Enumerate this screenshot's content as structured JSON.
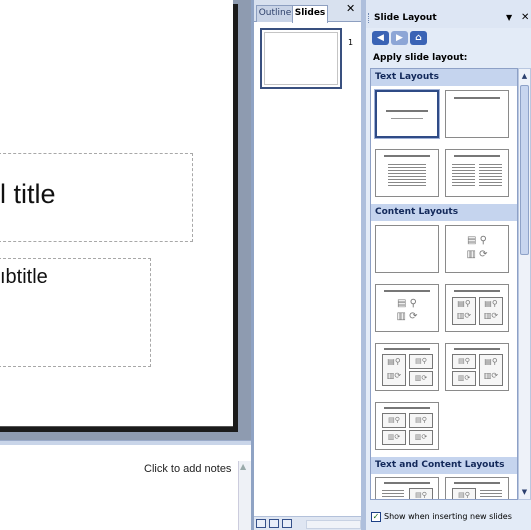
{
  "slide": {
    "title_fragment": "l title",
    "subtitle_fragment": "ıbtitle"
  },
  "notes": {
    "placeholder": "Click to add notes"
  },
  "slides_pane": {
    "tabs": [
      {
        "label": "Outline",
        "active": false
      },
      {
        "label": "Slides",
        "active": true
      }
    ],
    "close_glyph": "✕",
    "thumbnails": [
      {
        "number": "1"
      }
    ]
  },
  "task_pane": {
    "title": "Slide Layout",
    "menu_glyph": "▼",
    "close_glyph": "✕",
    "nav": {
      "back_icon": "back-arrow-icon",
      "forward_icon": "forward-arrow-icon",
      "home_icon": "home-icon"
    },
    "apply_label": "Apply slide layout:",
    "sections": [
      {
        "label": "Text Layouts",
        "layouts": [
          "title-slide",
          "title-only",
          "title-and-text",
          "title-and-two-column-text"
        ]
      },
      {
        "label": "Content Layouts",
        "layouts": [
          "blank",
          "content",
          "title-and-content",
          "title-and-two-content",
          "title-content-over-two",
          "title-two-over-content",
          "title-and-four-content"
        ]
      },
      {
        "label": "Text and Content Layouts",
        "layouts": [
          "title-text-and-content",
          "title-content-and-text"
        ]
      }
    ],
    "show_when_inserting": {
      "checked": true,
      "label": "Show when inserting new slides"
    }
  },
  "colors": {
    "accent": "#3a63b5",
    "pane_background": "#e3ebf7",
    "section_header": "#c5d4ee",
    "workspace": "#8e9bb0"
  }
}
